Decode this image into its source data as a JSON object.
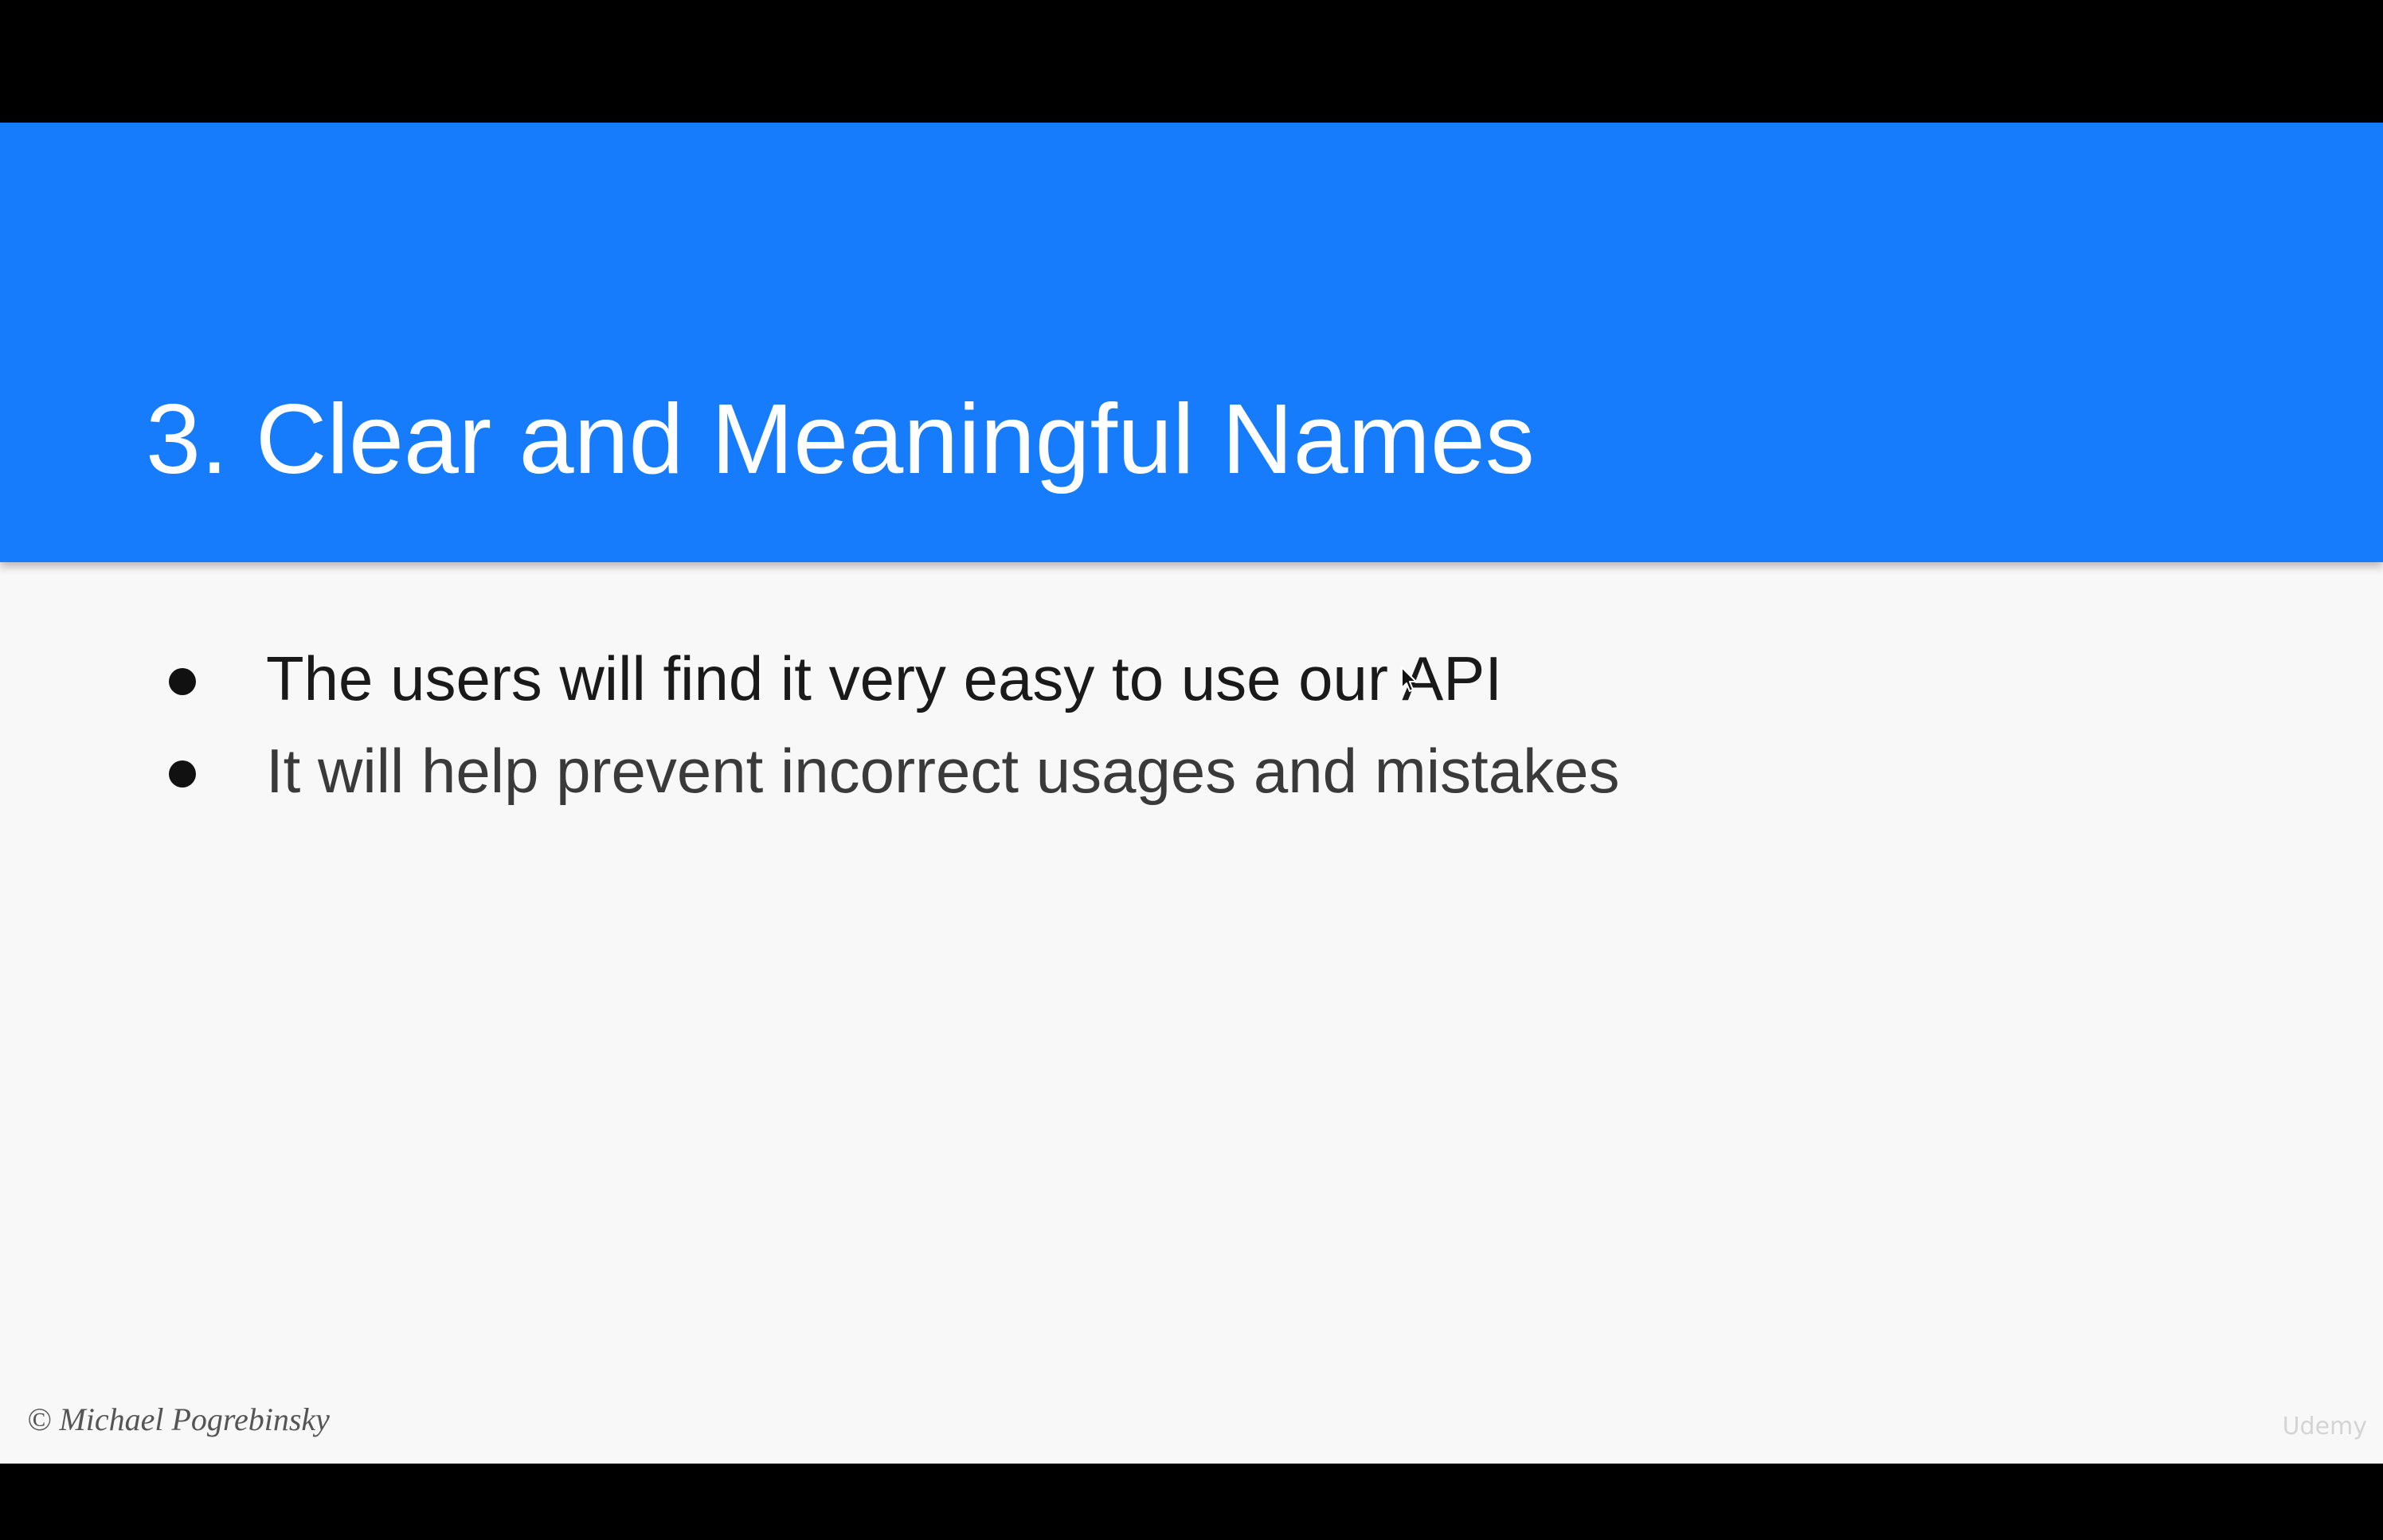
{
  "slide": {
    "title": "3. Clear and Meaningful Names",
    "bullets": [
      "The users will find it very easy to use our API",
      "It will help prevent incorrect usages and mistakes"
    ],
    "copyright": "© Michael Pogrebinsky",
    "watermark": "Udemy"
  },
  "colors": {
    "title_bar": "#167cfb",
    "slide_background": "#f8f8f8",
    "letterbox": "#000000"
  },
  "icons": {
    "bullet": "bullet-dot-icon",
    "cursor": "mouse-pointer-icon"
  }
}
